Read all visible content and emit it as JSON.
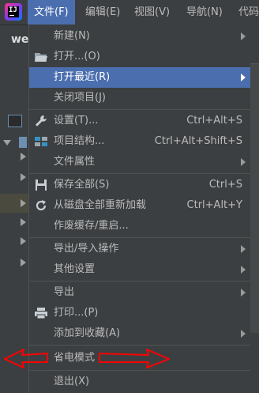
{
  "menubar": {
    "items": [
      {
        "label": "文件(F)",
        "active": true
      },
      {
        "label": "编辑(E)"
      },
      {
        "label": "视图(V)"
      },
      {
        "label": "导航(N)"
      },
      {
        "label": "代码"
      }
    ]
  },
  "toolbar": {
    "tab_label": "we"
  },
  "file_menu": {
    "items": [
      {
        "label": "新建(N)",
        "submenu": true
      },
      {
        "label": "打开...(O)",
        "icon": "folder-icon"
      },
      {
        "label": "打开最近(R)",
        "submenu": true,
        "highlighted": true
      },
      {
        "label": "关闭项目(J)"
      },
      {
        "label": "设置(T)...",
        "icon": "wrench-icon",
        "shortcut": "Ctrl+Alt+S"
      },
      {
        "label": "项目结构...",
        "icon": "project-structure-icon",
        "shortcut": "Ctrl+Alt+Shift+S"
      },
      {
        "label": "文件属性",
        "submenu": true
      },
      {
        "label": "保存全部(S)",
        "icon": "save-icon",
        "shortcut": "Ctrl+S"
      },
      {
        "label": "从磁盘全部重新加载",
        "icon": "reload-icon",
        "shortcut": "Ctrl+Alt+Y"
      },
      {
        "label": "作废缓存/重启..."
      },
      {
        "label": "导出/导入操作",
        "submenu": true
      },
      {
        "label": "其他设置",
        "submenu": true
      },
      {
        "label": "导出",
        "submenu": true
      },
      {
        "label": "打印...(P)",
        "icon": "print-icon"
      },
      {
        "label": "添加到收藏(A)",
        "submenu": true
      },
      {
        "label": "省电模式"
      },
      {
        "label": "退出(X)"
      }
    ]
  },
  "colors": {
    "highlight": "#4b6eaf",
    "background": "#3c3f41",
    "annotation": "#ff0000"
  }
}
